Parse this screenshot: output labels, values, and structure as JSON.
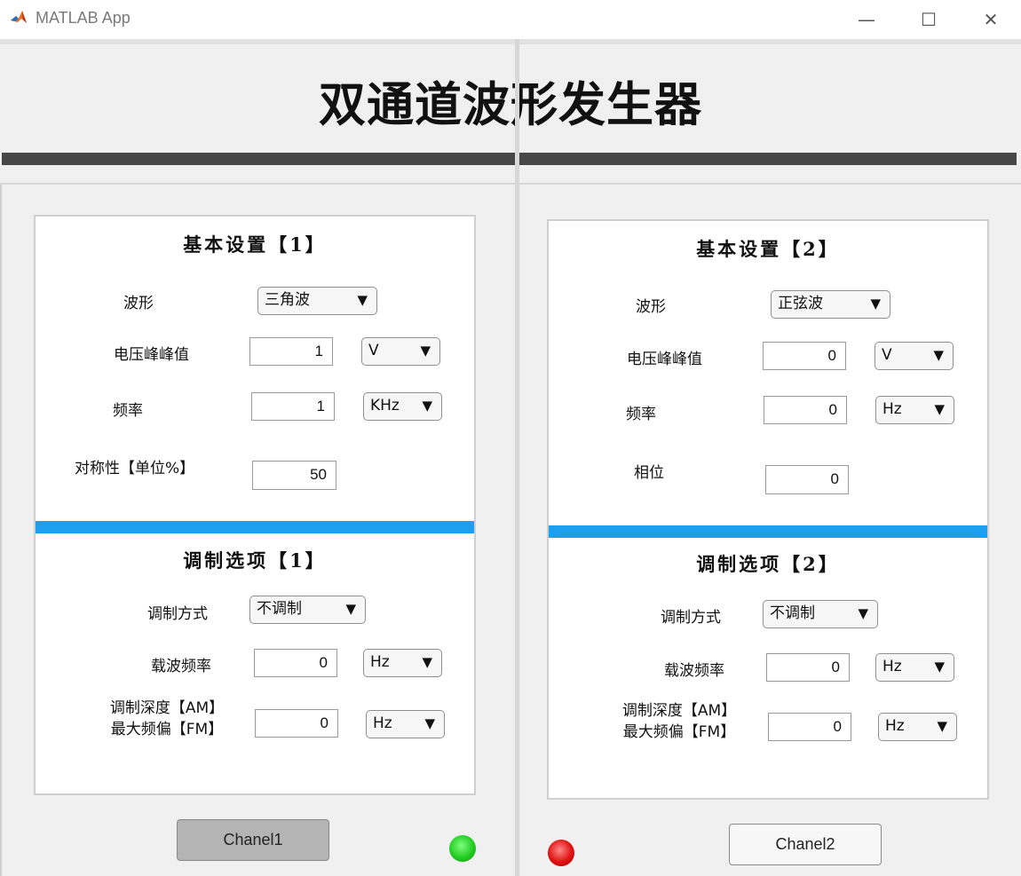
{
  "window": {
    "title": "MATLAB App",
    "controls": {
      "minimize": "—",
      "maximize": "☐",
      "close": "✕"
    }
  },
  "header": {
    "title": "双通道波形发生器"
  },
  "channel1": {
    "basic": {
      "title": "基本设置【1】",
      "waveform_label": "波形",
      "waveform_value": "三角波",
      "amplitude_label": "电压峰峰值",
      "amplitude_value": "1",
      "amplitude_unit": "V",
      "frequency_label": "频率",
      "frequency_value": "1",
      "frequency_unit": "KHz",
      "symmetry_label": "对称性【单位%】",
      "symmetry_value": "50"
    },
    "modulation": {
      "title": "调制选项【1】",
      "mode_label": "调制方式",
      "mode_value": "不调制",
      "carrier_label": "载波频率",
      "carrier_value": "0",
      "carrier_unit": "Hz",
      "depth_label_line1": "调制深度【AM】",
      "depth_label_line2": "最大频偏【FM】",
      "depth_value": "0",
      "depth_unit": "Hz"
    },
    "button_label": "Chanel1",
    "lamp_color": "#22cc22"
  },
  "channel2": {
    "basic": {
      "title": "基本设置【2】",
      "waveform_label": "波形",
      "waveform_value": "正弦波",
      "amplitude_label": "电压峰峰值",
      "amplitude_value": "0",
      "amplitude_unit": "V",
      "frequency_label": "频率",
      "frequency_value": "0",
      "frequency_unit": "Hz",
      "phase_label": "相位",
      "phase_value": "0"
    },
    "modulation": {
      "title": "调制选项【2】",
      "mode_label": "调制方式",
      "mode_value": "不调制",
      "carrier_label": "载波频率",
      "carrier_value": "0",
      "carrier_unit": "Hz",
      "depth_label_line1": "调制深度【AM】",
      "depth_label_line2": "最大频偏【FM】",
      "depth_value": "0",
      "depth_unit": "Hz"
    },
    "button_label": "Chanel2",
    "lamp_color": "#e01010"
  },
  "colors": {
    "accent_bar": "#1d9ff0",
    "header_bar": "#474747"
  }
}
